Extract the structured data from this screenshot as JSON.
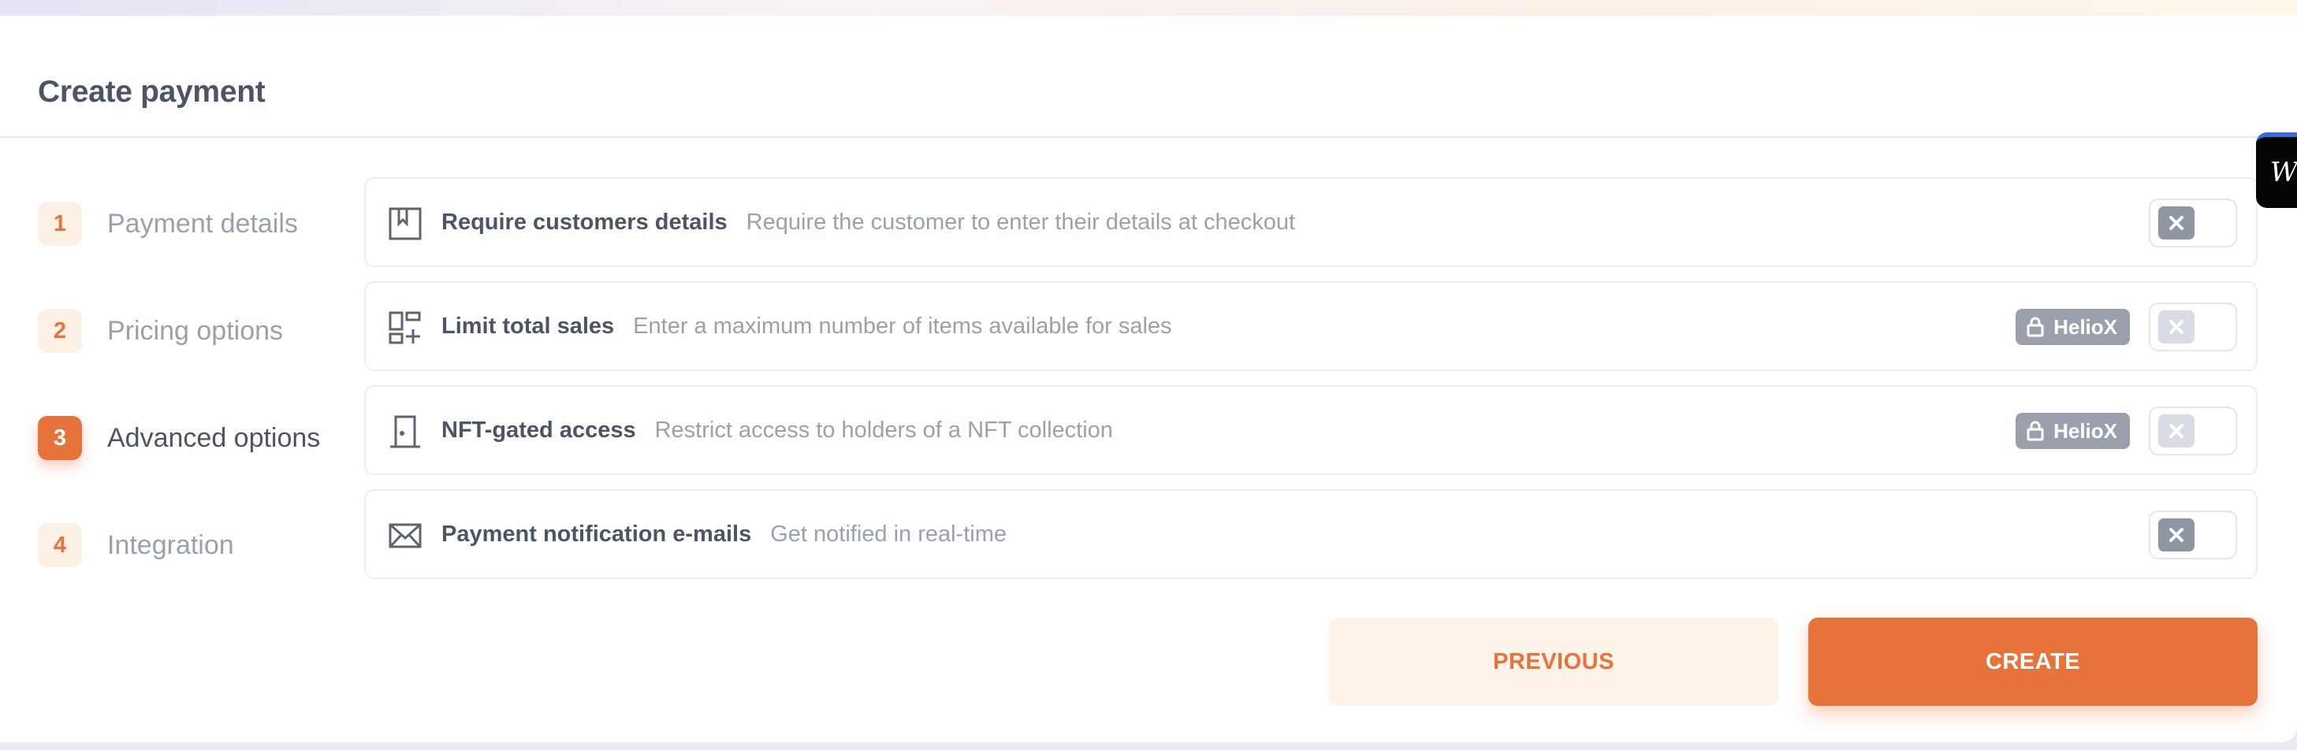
{
  "header": {
    "title": "Create payment"
  },
  "steps": [
    {
      "number": "1",
      "label": "Payment details"
    },
    {
      "number": "2",
      "label": "Pricing options"
    },
    {
      "number": "3",
      "label": "Advanced options",
      "active": true
    },
    {
      "number": "4",
      "label": "Integration"
    }
  ],
  "options": [
    {
      "title": "Require customers details",
      "description": "Require the customer to enter their details at checkout",
      "icon": "bookmark-card-icon",
      "enabled": false
    },
    {
      "title": "Limit total sales",
      "description": "Enter a maximum number of items available for sales",
      "icon": "widgets-add-icon",
      "badge": "HelioX",
      "locked": true,
      "enabled": false
    },
    {
      "title": "NFT-gated access",
      "description": "Restrict access to holders of a NFT collection",
      "icon": "door-icon",
      "badge": "HelioX",
      "locked": true,
      "enabled": false
    },
    {
      "title": "Payment notification e-mails",
      "description": "Get notified in real-time",
      "icon": "mail-icon",
      "enabled": false
    }
  ],
  "actions": {
    "previous": "PREVIOUS",
    "create": "CREATE"
  },
  "side_widget": {
    "glyph": "W"
  },
  "colors": {
    "accent": "#e5733a",
    "accent_light": "#fdf3e8",
    "text_dark": "#4b5565",
    "text_muted": "#9aa1ad"
  }
}
